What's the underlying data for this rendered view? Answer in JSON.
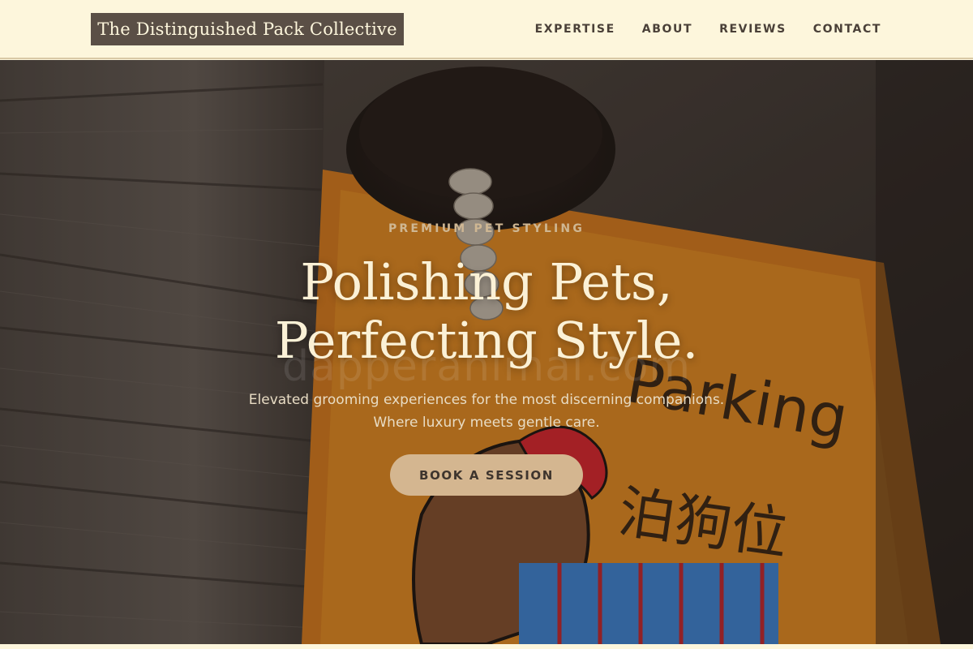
{
  "header": {
    "brand": "The Distinguished Pack Collective",
    "nav": [
      {
        "label": "EXPERTISE"
      },
      {
        "label": "ABOUT"
      },
      {
        "label": "REVIEWS"
      },
      {
        "label": "CONTACT"
      }
    ]
  },
  "hero": {
    "eyebrow": "PREMIUM PET STYLING",
    "headline_line1": "Polishing Pets,",
    "headline_line2": "Perfecting Style.",
    "subtext_line1": "Elevated grooming experiences for the most discerning companions.",
    "subtext_line2": "Where luxury meets gentle care.",
    "cta_label": "BOOK A SESSION",
    "watermark": "dapperanimal.com",
    "sign_text": "Parking",
    "sign_cn": "泊狗位"
  },
  "colors": {
    "header_bg": "#fdf6dc",
    "brand_bg": "#5a4f46",
    "accent": "#d4b690",
    "headline": "#fbf1d6"
  }
}
